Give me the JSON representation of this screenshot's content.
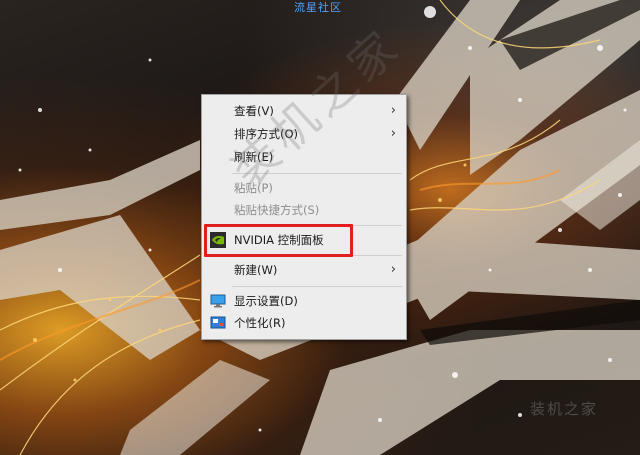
{
  "watermark": {
    "top_text": "流星社区",
    "middle_text": "装机之家",
    "corner_text": "装机之家"
  },
  "context_menu": {
    "items": [
      {
        "label": "查看(V)",
        "has_submenu": true,
        "enabled": true
      },
      {
        "label": "排序方式(O)",
        "has_submenu": true,
        "enabled": true
      },
      {
        "label": "刷新(E)",
        "has_submenu": false,
        "enabled": true
      },
      {
        "label": "粘贴(P)",
        "has_submenu": false,
        "enabled": false
      },
      {
        "label": "粘贴快捷方式(S)",
        "has_submenu": false,
        "enabled": false
      },
      {
        "label": "NVIDIA 控制面板",
        "has_submenu": false,
        "enabled": true,
        "icon": "nvidia-icon",
        "highlighted": true
      },
      {
        "label": "新建(W)",
        "has_submenu": true,
        "enabled": true
      },
      {
        "label": "显示设置(D)",
        "has_submenu": false,
        "enabled": true,
        "icon": "display-settings-icon"
      },
      {
        "label": "个性化(R)",
        "has_submenu": false,
        "enabled": true,
        "icon": "personalize-icon"
      }
    ]
  },
  "colors": {
    "highlight_border": "#e01f1f",
    "menu_bg": "#ededed",
    "nvidia_green": "#76b900"
  }
}
